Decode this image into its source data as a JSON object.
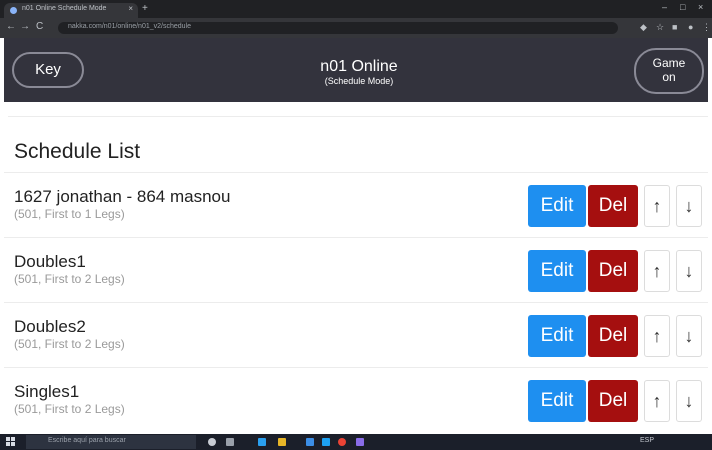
{
  "browser": {
    "tab_title": "n01 Online Schedule Mode",
    "tab_close": "×",
    "new_tab": "+",
    "minimize": "–",
    "maximize": "□",
    "close": "×",
    "back": "←",
    "forward": "→",
    "reload": "C",
    "url": "nakka.com/n01/online/n01_v2/schedule"
  },
  "header": {
    "key_label": "Key",
    "title": "n01 Online",
    "subtitle": "(Schedule Mode)",
    "game_on_line1": "Game",
    "game_on_line2": "on"
  },
  "schedule": {
    "heading": "Schedule List",
    "edit_label": "Edit",
    "del_label": "Del",
    "up_label": "↑",
    "down_label": "↓",
    "items": [
      {
        "name": "1627 jonathan - 864 masnou",
        "details": "(501, First to 1 Legs)"
      },
      {
        "name": "Doubles1",
        "details": "(501, First to 2 Legs)"
      },
      {
        "name": "Doubles2",
        "details": "(501, First to 2 Legs)"
      },
      {
        "name": "Singles1",
        "details": "(501, First to 2 Legs)"
      }
    ]
  },
  "taskbar": {
    "search_placeholder": "Escribe aquí para buscar",
    "tray_text": "ESP"
  },
  "colors": {
    "header_bg": "#33333d",
    "edit_button": "#1e8ff0",
    "delete_button": "#a50f0f"
  }
}
